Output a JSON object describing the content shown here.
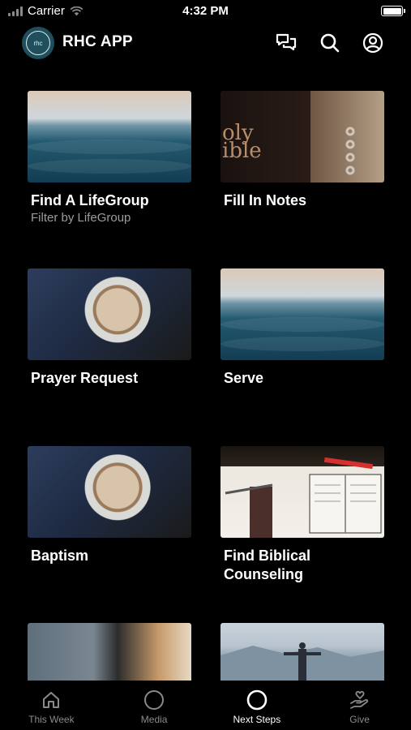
{
  "status_bar": {
    "carrier": "Carrier",
    "time": "4:32 PM"
  },
  "header": {
    "app_title": "RHC APP",
    "logo_text": "rhc"
  },
  "cards": [
    {
      "title": "Find A LifeGroup",
      "subtitle": "Filter by LifeGroup",
      "image": "ocean"
    },
    {
      "title": "Fill In Notes",
      "subtitle": "",
      "image": "bible-notebook"
    },
    {
      "title": "Prayer Request",
      "subtitle": "",
      "image": "coffee-latte"
    },
    {
      "title": "Serve",
      "subtitle": "",
      "image": "ocean"
    },
    {
      "title": "Baptism",
      "subtitle": "",
      "image": "coffee-latte"
    },
    {
      "title": "Find Biblical Counseling",
      "subtitle": "",
      "image": "bible-study"
    },
    {
      "title": "",
      "subtitle": "",
      "image": "street"
    },
    {
      "title": "",
      "subtitle": "",
      "image": "mountain-person"
    }
  ],
  "tabbar": {
    "active": "Next Steps",
    "tabs": [
      {
        "label": "This Week",
        "icon": "home-icon"
      },
      {
        "label": "Media",
        "icon": "circle-icon"
      },
      {
        "label": "Next Steps",
        "icon": "circle-icon"
      },
      {
        "label": "Give",
        "icon": "hand-heart-icon"
      }
    ]
  },
  "colors": {
    "background": "#000000",
    "text": "#ffffff",
    "muted": "#9c9c9c",
    "logo_bg": "#1f4e5c"
  }
}
